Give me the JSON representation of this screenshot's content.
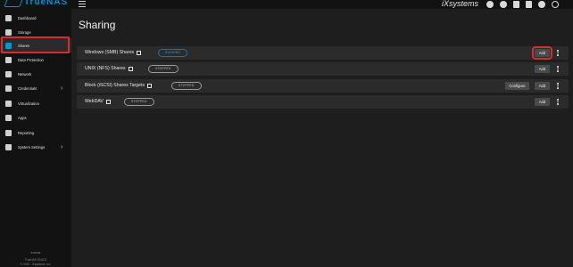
{
  "brand": {
    "name": "TrueNAS",
    "company": "iXsystems"
  },
  "header": {
    "icons": [
      "truecommand-icon",
      "jobs-icon",
      "clipboard-icon",
      "bell-icon",
      "user-icon",
      "power-icon"
    ]
  },
  "sidebar": {
    "items": [
      {
        "label": "Dashboard",
        "icon": "dashboard-icon"
      },
      {
        "label": "Storage",
        "icon": "storage-icon"
      },
      {
        "label": "Shares",
        "icon": "shares-icon",
        "active": true
      },
      {
        "label": "Data Protection",
        "icon": "shield-icon"
      },
      {
        "label": "Network",
        "icon": "network-icon"
      },
      {
        "label": "Credentials",
        "icon": "key-icon",
        "has_children": true
      },
      {
        "label": "Virtualization",
        "icon": "monitor-icon"
      },
      {
        "label": "Apps",
        "icon": "apps-icon"
      },
      {
        "label": "Reporting",
        "icon": "chart-icon"
      },
      {
        "label": "System Settings",
        "icon": "gear-icon",
        "has_children": true
      }
    ],
    "footer": {
      "line1": "truenas",
      "line2": "TrueNAS SCALE",
      "line3": "© 2023 - iXsystems, Inc."
    }
  },
  "main": {
    "title": "Sharing",
    "shares": [
      {
        "name": "Windows (SMB) Shares",
        "status": "RUNNING",
        "buttons": [
          "Add"
        ]
      },
      {
        "name": "UNIX (NFS) Shares",
        "status": "STOPPED",
        "buttons": [
          "Add"
        ]
      },
      {
        "name": "Block (iSCSI) Shares Targets",
        "status": "STOPPED",
        "buttons": [
          "Configure",
          "Add"
        ]
      },
      {
        "name": "WebDAV",
        "status": "STOPPED",
        "buttons": [
          "Add"
        ]
      }
    ]
  },
  "colors": {
    "accent": "#0095d5",
    "highlight": "#d32f2f",
    "running": "#3a9ad9"
  }
}
